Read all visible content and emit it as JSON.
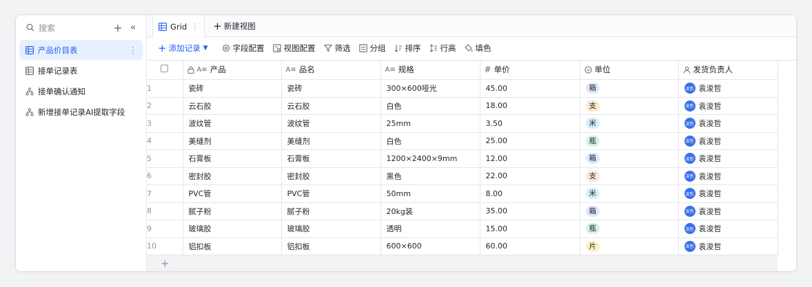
{
  "sidebar": {
    "search_placeholder": "搜索",
    "add_label": "+",
    "collapse_label": "«",
    "items": [
      {
        "label": "产品价目表",
        "icon": "table-icon",
        "active": true,
        "more": "⋮"
      },
      {
        "label": "接单记录表",
        "icon": "table-icon",
        "active": false
      },
      {
        "label": "接单确认通知",
        "icon": "workflow-icon",
        "active": false
      },
      {
        "label": "新增接单记录AI提取字段",
        "icon": "workflow-icon",
        "active": false
      }
    ]
  },
  "tabs": {
    "active_label": "Grid",
    "active_more": "⋮",
    "new_label": "新建视图"
  },
  "toolbar": {
    "add_record": "添加记录",
    "field_config": "字段配置",
    "view_config": "视图配置",
    "filter": "筛选",
    "group": "分组",
    "sort": "排序",
    "row_height": "行高",
    "fill_color": "填色"
  },
  "grid": {
    "columns": [
      "产品",
      "品名",
      "规格",
      "单价",
      "单位",
      "发货负责人"
    ],
    "rows": [
      {
        "n": "1",
        "product": "瓷砖",
        "name": "瓷砖",
        "spec": "300×600哑光",
        "price": "45.00",
        "unit": "箱",
        "owner": "袁浚哲"
      },
      {
        "n": "2",
        "product": "云石胶",
        "name": "云石胶",
        "spec": "白色",
        "price": "18.00",
        "unit": "支",
        "owner": "袁浚哲"
      },
      {
        "n": "3",
        "product": "波纹管",
        "name": "波纹管",
        "spec": "25mm",
        "price": "3.50",
        "unit": "米",
        "owner": "袁浚哲"
      },
      {
        "n": "4",
        "product": "美缝剂",
        "name": "美缝剂",
        "spec": "白色",
        "price": "25.00",
        "unit": "瓶",
        "owner": "袁浚哲"
      },
      {
        "n": "5",
        "product": "石膏板",
        "name": "石膏板",
        "spec": "1200×2400×9mm",
        "price": "12.00",
        "unit": "箱",
        "owner": "袁浚哲"
      },
      {
        "n": "6",
        "product": "密封胶",
        "name": "密封胶",
        "spec": "黑色",
        "price": "22.00",
        "unit": "支",
        "owner": "袁浚哲"
      },
      {
        "n": "7",
        "product": "PVC管",
        "name": "PVC管",
        "spec": "50mm",
        "price": "8.00",
        "unit": "米",
        "owner": "袁浚哲"
      },
      {
        "n": "8",
        "product": "腻子粉",
        "name": "腻子粉",
        "spec": "20kg装",
        "price": "35.00",
        "unit": "箱",
        "owner": "袁浚哲"
      },
      {
        "n": "9",
        "product": "玻璃胶",
        "name": "玻璃胶",
        "spec": "透明",
        "price": "15.00",
        "unit": "瓶",
        "owner": "袁浚哲"
      },
      {
        "n": "10",
        "product": "铝扣板",
        "name": "铝扣板",
        "spec": "600×600",
        "price": "60.00",
        "unit": "片",
        "owner": "袁浚哲"
      }
    ],
    "unit_colors": {
      "箱": "#e1e7fb",
      "支": "#fde7cf",
      "米": "#d6f0fa",
      "瓶": "#d5f2ea",
      "片": "#fdeec5"
    },
    "avatar_text": "袁浚哲",
    "avatar_color": "#3a6fe8",
    "add_row_label": "+"
  },
  "colors": {
    "accent": "#1f5ff5",
    "active_bg": "#e8f0ff"
  }
}
